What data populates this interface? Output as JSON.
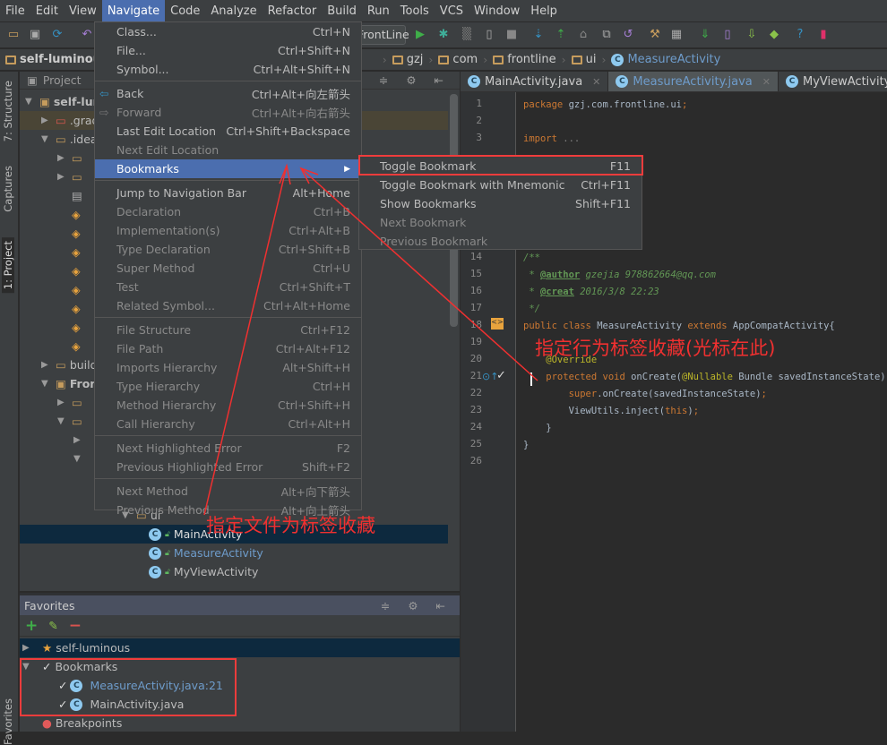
{
  "menubar": [
    "File",
    "Edit",
    "View",
    "Navigate",
    "Code",
    "Analyze",
    "Refactor",
    "Build",
    "Run",
    "Tools",
    "VCS",
    "Window",
    "Help"
  ],
  "toolbar": {
    "run_config": "FrontLine",
    "icons": [
      "open-folder-icon",
      "save-icon",
      "sync-icon",
      "undo-icon",
      "run-icon",
      "debug-icon",
      "coverage-icon",
      "attach-debugger-icon",
      "stop-icon",
      "vcs-update-icon",
      "vcs-commit-icon",
      "vcs-history-icon",
      "compare-icon",
      "revert-icon",
      "settings-icon",
      "project-structure-icon",
      "sync-gradle-icon",
      "avd-manager-icon",
      "sdk-manager-icon",
      "android-icon",
      "help-icon",
      "device-monitor-icon"
    ]
  },
  "breadcrumb": [
    "self-luminous",
    "gzj",
    "com",
    "frontline",
    "ui",
    "MeasureActivity"
  ],
  "left_strip": [
    "7: Structure",
    "Captures",
    "1: Project",
    "Favorites"
  ],
  "project": {
    "title": "Project",
    "tree": [
      {
        "label": "self-luminous",
        "depth": 0,
        "exp": "down",
        "icon": "module"
      },
      {
        "label": ".gradle",
        "depth": 1,
        "exp": "right",
        "icon": "folder-red"
      },
      {
        "label": ".idea",
        "depth": 1,
        "exp": "down",
        "icon": "folder"
      },
      {
        "label": "",
        "depth": 2,
        "exp": "right",
        "icon": "folder"
      },
      {
        "label": "",
        "depth": 2,
        "exp": "right",
        "icon": "folder"
      },
      {
        "label": "",
        "depth": 2,
        "exp": "",
        "icon": "file"
      },
      {
        "label": "",
        "depth": 2,
        "exp": "",
        "icon": "xml"
      },
      {
        "label": "",
        "depth": 2,
        "exp": "",
        "icon": "xml"
      },
      {
        "label": "",
        "depth": 2,
        "exp": "",
        "icon": "xml"
      },
      {
        "label": "",
        "depth": 2,
        "exp": "",
        "icon": "xml"
      },
      {
        "label": "",
        "depth": 2,
        "exp": "",
        "icon": "xml"
      },
      {
        "label": "",
        "depth": 2,
        "exp": "",
        "icon": "xml"
      },
      {
        "label": "",
        "depth": 2,
        "exp": "",
        "icon": "xml"
      },
      {
        "label": "",
        "depth": 2,
        "exp": "",
        "icon": "xml"
      },
      {
        "label": "build",
        "depth": 1,
        "exp": "right",
        "icon": "folder"
      },
      {
        "label": "Frontline",
        "depth": 1,
        "exp": "down",
        "icon": "android-module"
      },
      {
        "label": "",
        "depth": 2,
        "exp": "right",
        "icon": "folder"
      },
      {
        "label": "",
        "depth": 2,
        "exp": "down",
        "icon": "folder"
      },
      {
        "label": "",
        "depth": 3,
        "exp": "right",
        "icon": ""
      },
      {
        "label": "",
        "depth": 3,
        "exp": "down",
        "icon": ""
      },
      {
        "label": "",
        "depth": 4,
        "exp": "",
        "icon": ""
      },
      {
        "label": "",
        "depth": 4,
        "exp": "",
        "icon": ""
      },
      {
        "label": "ui",
        "depth": 6,
        "exp": "down",
        "icon": "package"
      },
      {
        "label": "MainActivity",
        "depth": 7,
        "exp": "",
        "icon": "class",
        "selected": true
      },
      {
        "label": "MeasureActivity",
        "depth": 7,
        "exp": "",
        "icon": "class",
        "blue": true
      },
      {
        "label": "MyViewActivity",
        "depth": 7,
        "exp": "",
        "icon": "class"
      }
    ]
  },
  "editor": {
    "tabs": [
      {
        "label": "MainActivity.java",
        "active": false
      },
      {
        "label": "MeasureActivity.java",
        "active": true
      },
      {
        "label": "MyViewActivity.java",
        "active": false
      }
    ],
    "lines": [
      {
        "n": "1",
        "row": 0,
        "toks": [
          [
            "kw",
            "package "
          ],
          [
            "",
            "gzj.com.frontline.ui"
          ],
          [
            "kw",
            ";"
          ]
        ]
      },
      {
        "n": "2",
        "row": 1,
        "toks": []
      },
      {
        "n": "3",
        "row": 2,
        "toks": [
          [
            "kw",
            "import "
          ],
          [
            "gr",
            "..."
          ]
        ]
      },
      {
        "n": "14",
        "row": 9,
        "toks": [
          [
            "cm",
            "/**"
          ]
        ]
      },
      {
        "n": "15",
        "row": 10,
        "toks": [
          [
            "cm",
            " * "
          ],
          [
            "tag",
            "@author"
          ],
          [
            "cm",
            " gzejia 978862664@qq.com"
          ]
        ]
      },
      {
        "n": "16",
        "row": 11,
        "toks": [
          [
            "cm",
            " * "
          ],
          [
            "tag",
            "@creat"
          ],
          [
            "cm",
            " 2016/3/8 22:23"
          ]
        ]
      },
      {
        "n": "17",
        "row": 12,
        "toks": [
          [
            "cm",
            " */"
          ]
        ]
      },
      {
        "n": "18",
        "row": 13,
        "toks": [
          [
            "kw",
            "public class "
          ],
          [
            "",
            "MeasureActivity "
          ],
          [
            "kw",
            "extends "
          ],
          [
            "",
            "AppCompatActivity{"
          ]
        ]
      },
      {
        "n": "19",
        "row": 14,
        "toks": []
      },
      {
        "n": "20",
        "row": 15,
        "toks": [
          [
            "an",
            "    @Override"
          ]
        ]
      },
      {
        "n": "21",
        "row": 16,
        "toks": [
          [
            "kw",
            "    protected void "
          ],
          [
            "",
            "onCreate("
          ],
          [
            "an",
            "@Nullable "
          ],
          [
            "",
            "Bundle savedInstanceState) {"
          ]
        ]
      },
      {
        "n": "22",
        "row": 17,
        "toks": [
          [
            "kw",
            "        super"
          ],
          [
            "",
            ".onCreate(savedInstanceState)"
          ],
          [
            "kw",
            ";"
          ]
        ]
      },
      {
        "n": "23",
        "row": 18,
        "toks": [
          [
            "",
            "        ViewUtils."
          ],
          [
            "",
            "inject("
          ],
          [
            "kw",
            "this"
          ],
          [
            "",
            ")"
          ],
          [
            "kw",
            ";"
          ]
        ]
      },
      {
        "n": "24",
        "row": 19,
        "toks": [
          [
            "",
            "    }"
          ]
        ]
      },
      {
        "n": "25",
        "row": 20,
        "toks": [
          [
            "",
            "}"
          ]
        ]
      },
      {
        "n": "26",
        "row": 21,
        "toks": []
      }
    ]
  },
  "favorites": {
    "title": "Favorites",
    "items": [
      {
        "label": "self-luminous",
        "depth": 0,
        "icon": "star-icon"
      },
      {
        "label": "Bookmarks",
        "depth": 0,
        "icon": "check-icon"
      },
      {
        "label": "MeasureActivity.java:21",
        "depth": 1,
        "icon": "class",
        "blue": true
      },
      {
        "label": "MainActivity.java",
        "depth": 1,
        "icon": "class"
      },
      {
        "label": "Breakpoints",
        "depth": 0,
        "icon": "breakpoint-icon"
      }
    ]
  },
  "navigate_menu": [
    {
      "label": "Class...",
      "key": "Ctrl+N"
    },
    {
      "label": "File...",
      "key": "Ctrl+Shift+N"
    },
    {
      "label": "Symbol...",
      "key": "Ctrl+Alt+Shift+N"
    },
    {
      "sep": true
    },
    {
      "label": "Back",
      "key": "Ctrl+Alt+向左箭头",
      "icon": "back-icon"
    },
    {
      "label": "Forward",
      "key": "Ctrl+Alt+向右箭头",
      "icon": "forward-icon",
      "dis": true
    },
    {
      "label": "Last Edit Location",
      "key": "Ctrl+Shift+Backspace"
    },
    {
      "label": "Next Edit Location",
      "key": "",
      "dis": true
    },
    {
      "label": "Bookmarks",
      "key": "",
      "submenu": true,
      "hl": true
    },
    {
      "sep": true
    },
    {
      "label": "Jump to Navigation Bar",
      "key": "Alt+Home"
    },
    {
      "label": "Declaration",
      "key": "Ctrl+B",
      "dis": true
    },
    {
      "label": "Implementation(s)",
      "key": "Ctrl+Alt+B",
      "dis": true
    },
    {
      "label": "Type Declaration",
      "key": "Ctrl+Shift+B",
      "dis": true
    },
    {
      "label": "Super Method",
      "key": "Ctrl+U",
      "dis": true
    },
    {
      "label": "Test",
      "key": "Ctrl+Shift+T",
      "dis": true
    },
    {
      "label": "Related Symbol...",
      "key": "Ctrl+Alt+Home",
      "dis": true
    },
    {
      "sep": true
    },
    {
      "label": "File Structure",
      "key": "Ctrl+F12",
      "dis": true
    },
    {
      "label": "File Path",
      "key": "Ctrl+Alt+F12",
      "dis": true
    },
    {
      "label": "Imports Hierarchy",
      "key": "Alt+Shift+H",
      "dis": true
    },
    {
      "label": "Type Hierarchy",
      "key": "Ctrl+H",
      "dis": true
    },
    {
      "label": "Method Hierarchy",
      "key": "Ctrl+Shift+H",
      "dis": true
    },
    {
      "label": "Call Hierarchy",
      "key": "Ctrl+Alt+H",
      "dis": true
    },
    {
      "sep": true
    },
    {
      "label": "Next Highlighted Error",
      "key": "F2",
      "dis": true
    },
    {
      "label": "Previous Highlighted Error",
      "key": "Shift+F2",
      "dis": true
    },
    {
      "sep": true
    },
    {
      "label": "Next Method",
      "key": "Alt+向下箭头",
      "dis": true
    },
    {
      "label": "Previous Method",
      "key": "Alt+向上箭头",
      "dis": true
    }
  ],
  "bookmarks_submenu": [
    {
      "label": "Toggle Bookmark",
      "key": "F11"
    },
    {
      "label": "Toggle Bookmark with Mnemonic",
      "key": "Ctrl+F11"
    },
    {
      "label": "Show Bookmarks",
      "key": "Shift+F11"
    },
    {
      "label": "Next Bookmark",
      "key": "",
      "dis": true
    },
    {
      "label": "Previous Bookmark",
      "key": "",
      "dis": true
    }
  ],
  "annotations": {
    "line_bookmark": "指定行为标签收藏(光标在此)",
    "file_bookmark": "指定文件为标签收藏",
    "color": "#f03030"
  },
  "colors": {
    "menu_highlight": "#4b6eaf",
    "selection": "#0d293e",
    "link_blue": "#6e9ccb"
  }
}
